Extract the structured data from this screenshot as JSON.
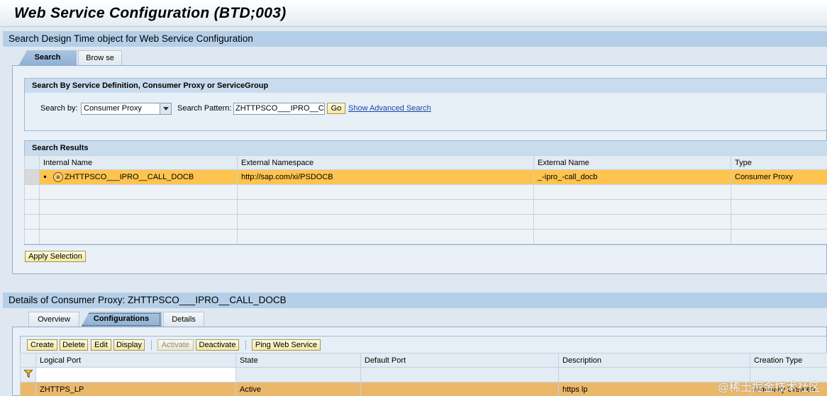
{
  "app": {
    "title": "Web Service Configuration (BTD;003)"
  },
  "search_section": {
    "title": "Search Design Time object for Web Service Configuration",
    "tabs": [
      {
        "label": "Search"
      },
      {
        "label": "Brow se"
      }
    ],
    "criteria": {
      "header": "Search By Service Definition, Consumer Proxy or ServiceGroup",
      "search_by_label": "Search by:",
      "search_by_value": "Consumer Proxy",
      "pattern_label": "Search Pattern:",
      "pattern_value": "ZHTTPSCO___IPRO__CALL_DOCB",
      "go_label": "Go",
      "advanced_link": "Show Advanced Search"
    },
    "results": {
      "header": "Search Results",
      "columns": [
        "Internal Name",
        "External Namespace",
        "External Name",
        "Type"
      ],
      "rows": [
        {
          "internal_name": "ZHTTPSCO___IPRO__CALL_DOCB",
          "namespace": "http://sap.com/xi/PSDOCB",
          "external_name": "_-ipro_-call_docb",
          "type": "Consumer Proxy"
        }
      ],
      "apply_label": "Apply Selection"
    }
  },
  "details_section": {
    "title": "Details of Consumer Proxy: ZHTTPSCO___IPRO__CALL_DOCB",
    "tabs": [
      {
        "label": "Overview"
      },
      {
        "label": "Configurations"
      },
      {
        "label": "Details"
      }
    ],
    "toolbar": {
      "create": "Create",
      "delete": "Delete",
      "edit": "Edit",
      "display": "Display",
      "activate": "Activate",
      "deactivate": "Deactivate",
      "ping": "Ping Web Service"
    },
    "grid": {
      "columns": [
        "Logical Port",
        "State",
        "Default Port",
        "Description",
        "Creation Type"
      ],
      "rows": [
        {
          "logical_port": "ZHTTPS_LP",
          "state": "Active",
          "default_port": "",
          "description": "https lp",
          "creation_type": "Manually Created"
        }
      ]
    }
  },
  "watermark": "@稀土掘金技术社区",
  "colors": {
    "highlight": "#ffc44f",
    "section_bar": "#b5cfe8",
    "button": "#f3e7a1"
  }
}
